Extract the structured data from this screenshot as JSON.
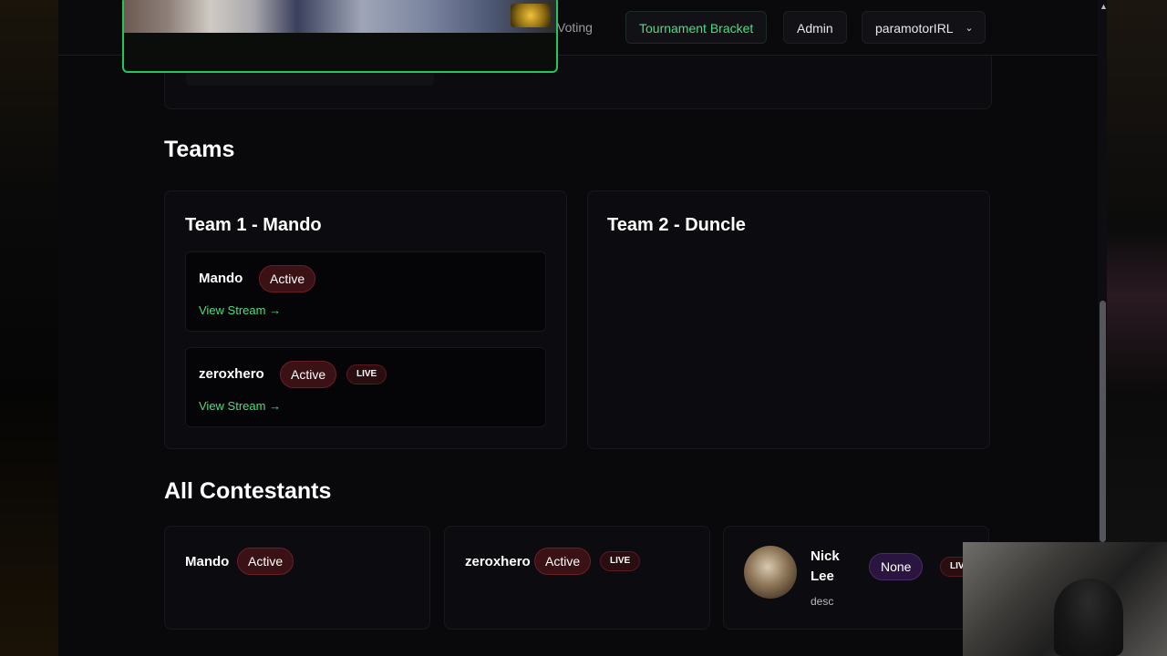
{
  "nav": {
    "voting_label": "Voting",
    "bracket_label": "Tournament Bracket",
    "admin_label": "Admin",
    "user_label": "paramotorIRL"
  },
  "teams": {
    "title": "Teams",
    "team1": {
      "title": "Team 1 - Mando",
      "members": [
        {
          "name": "Mando",
          "status": "Active",
          "link": "View Stream →"
        },
        {
          "name": "zeroxhero",
          "status": "Active",
          "live": "LIVE",
          "link": "View Stream →"
        }
      ]
    },
    "team2": {
      "title": "Team 2 - Duncle"
    }
  },
  "contestants": {
    "title": "All Contestants",
    "items": [
      {
        "name": "Mando",
        "status": "Active"
      },
      {
        "name": "zeroxhero",
        "status": "Active",
        "live": "LIVE"
      },
      {
        "name_line1": "Nick",
        "name_line2": "Lee",
        "status": "None",
        "live": "LIVE",
        "desc": "desc"
      }
    ]
  },
  "colors": {
    "accent_green": "#4ade80",
    "pip_border": "#22c55e",
    "active_badge_bg": "#3a1115",
    "none_badge_bg": "#2a1440"
  }
}
